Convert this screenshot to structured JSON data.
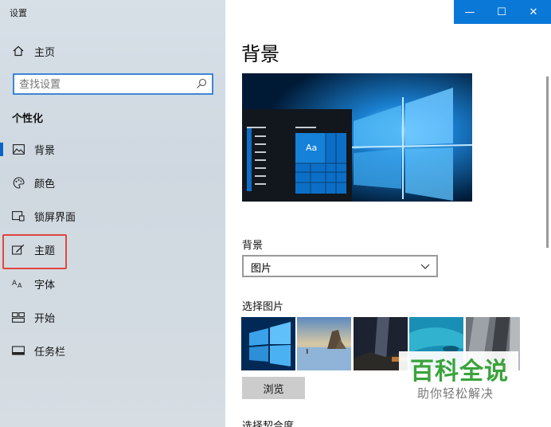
{
  "window": {
    "title": "设置"
  },
  "title_buttons": {
    "minimize": "—",
    "maximize": "☐",
    "close": "✕"
  },
  "sidebar": {
    "home_label": "主页",
    "search_placeholder": "查找设置",
    "section_title": "个性化",
    "items": [
      {
        "label": "背景",
        "icon": "picture-icon",
        "selected": true
      },
      {
        "label": "颜色",
        "icon": "palette-icon"
      },
      {
        "label": "锁屏界面",
        "icon": "lock-screen-icon"
      },
      {
        "label": "主题",
        "icon": "theme-brush-icon",
        "highlighted": true
      },
      {
        "label": "字体",
        "icon": "font-icon"
      },
      {
        "label": "开始",
        "icon": "start-icon"
      },
      {
        "label": "任务栏",
        "icon": "taskbar-icon"
      }
    ]
  },
  "main": {
    "page_title": "背景",
    "preview_sample_text": "Aa",
    "bg_label": "背景",
    "bg_value": "图片",
    "choose_label": "选择图片",
    "browse_label": "浏览",
    "fit_label": "选择契合度"
  },
  "watermark": {
    "title": "百科全说",
    "subtitle": "助你轻松解决"
  },
  "colors": {
    "accent": "#0a78d7",
    "highlight_box": "#e0463e",
    "watermark_green": "#3aa33a"
  }
}
